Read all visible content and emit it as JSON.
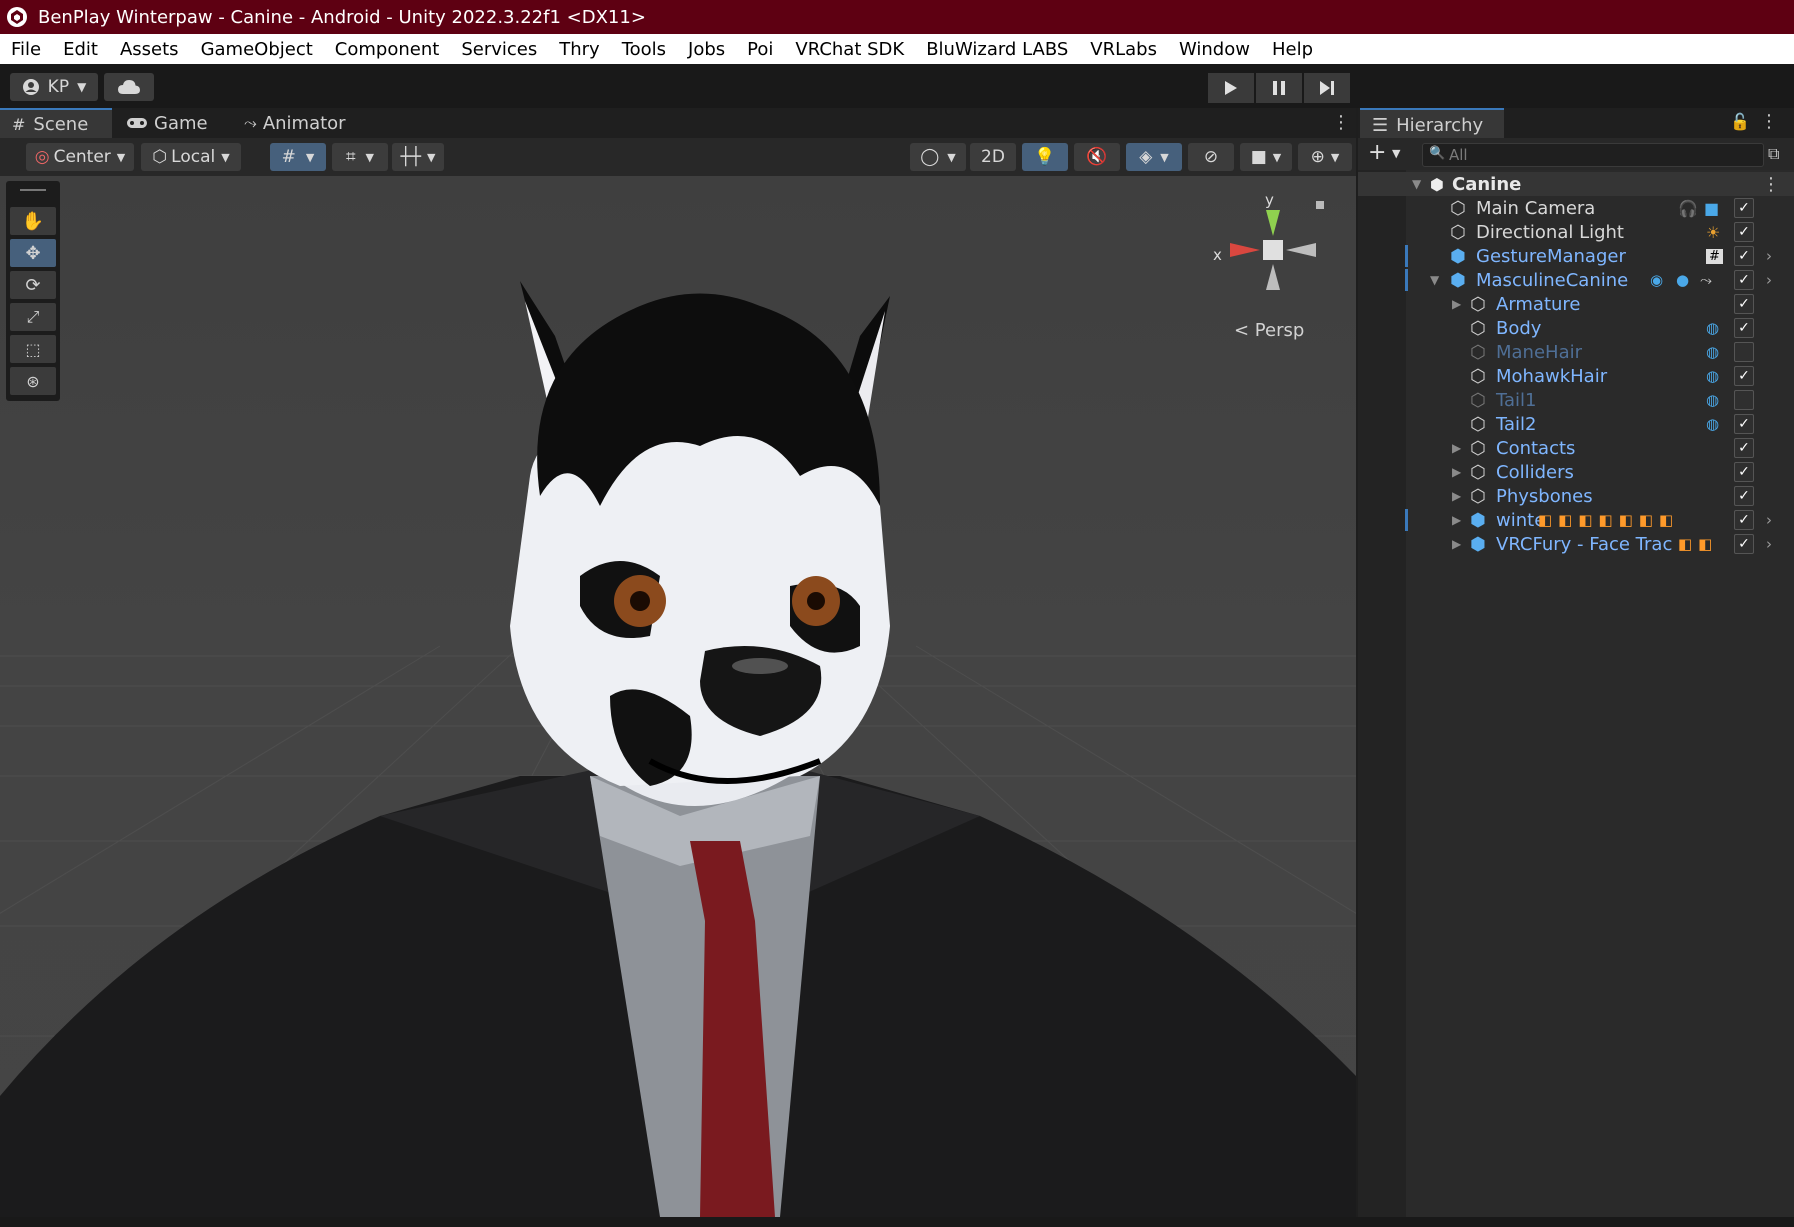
{
  "window": {
    "title": "BenPlay Winterpaw - Canine - Android - Unity 2022.3.22f1 <DX11>"
  },
  "menu": [
    "File",
    "Edit",
    "Assets",
    "GameObject",
    "Component",
    "Services",
    "Thry",
    "Tools",
    "Jobs",
    "Poi",
    "VRChat SDK",
    "BluWizard LABS",
    "VRLabs",
    "Window",
    "Help"
  ],
  "toolbar": {
    "account": "KP"
  },
  "tabs": {
    "scene": "Scene",
    "game": "Game",
    "animator": "Animator"
  },
  "scene_toolbar": {
    "pivot": "Center",
    "space": "Local",
    "mode2d": "2D"
  },
  "gizmo": {
    "y": "y",
    "x": "x",
    "projection": "< Persp"
  },
  "hierarchy": {
    "title": "Hierarchy",
    "search_placeholder": "All",
    "scene": "Canine",
    "items": [
      {
        "label": "Main Camera",
        "checked": true
      },
      {
        "label": "Directional Light",
        "checked": true
      },
      {
        "label": "GestureManager",
        "checked": true
      },
      {
        "label": "MasculineCanine",
        "checked": true
      },
      {
        "label": "Armature",
        "checked": true
      },
      {
        "label": "Body",
        "checked": true
      },
      {
        "label": "ManeHair",
        "checked": false
      },
      {
        "label": "MohawkHair",
        "checked": true
      },
      {
        "label": "Tail1",
        "checked": false
      },
      {
        "label": "Tail2",
        "checked": true
      },
      {
        "label": "Contacts",
        "checked": true
      },
      {
        "label": "Colliders",
        "checked": true
      },
      {
        "label": "Physbones",
        "checked": true
      },
      {
        "label": "winte",
        "checked": true
      },
      {
        "label": "VRCFury - Face Trac",
        "checked": true
      }
    ]
  },
  "colors": {
    "title_bar": "#5e0012",
    "accent_blue": "#3a79bb",
    "prefab_text": "#7fb6ff"
  }
}
